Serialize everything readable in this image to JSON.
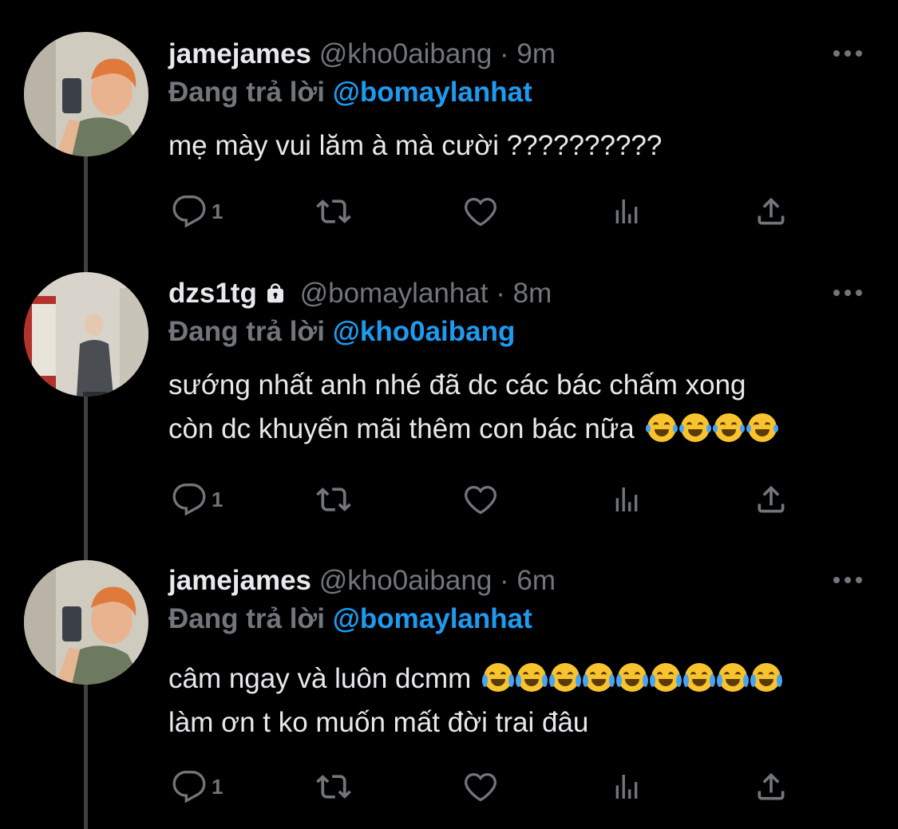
{
  "tweets": [
    {
      "name": "jamejames",
      "handle": "@kho0aibang",
      "dot": "·",
      "time": "9m",
      "replying_prefix": "Đang trả lời",
      "replying_to": "@bomaylanhat",
      "lines": [
        "mẹ mày vui lăm à mà cười ??????????"
      ],
      "reply_count": "1",
      "locked": false
    },
    {
      "name": "dzs1tg",
      "handle": "@bomaylanhat",
      "dot": "·",
      "time": "8m",
      "replying_prefix": "Đang trả lời",
      "replying_to": "@kho0aibang",
      "lines": [
        "sướng nhất anh nhé đã dc các bác chấm xong",
        "còn dc khuyến mãi thêm con bác nữa"
      ],
      "emoji_line": 1,
      "emoji_count": 4,
      "emoji_kind": "joy",
      "reply_count": "1",
      "locked": true
    },
    {
      "name": "jamejames",
      "handle": "@kho0aibang",
      "dot": "·",
      "time": "6m",
      "replying_prefix": "Đang trả lời",
      "replying_to": "@bomaylanhat",
      "lines": [
        "câm ngay và luôn dcmm",
        "làm ơn t ko muốn mất đời trai đâu"
      ],
      "emoji_line": 0,
      "emoji_count": 9,
      "emoji_kind": "sob",
      "reply_count": "1",
      "locked": false
    }
  ],
  "icons": {
    "more": "more-horizontal-icon",
    "reply": "reply-icon",
    "retweet": "retweet-icon",
    "like": "heart-icon",
    "views": "views-chart-icon",
    "share": "share-icon",
    "lock": "lock-icon"
  },
  "colors": {
    "background": "#000000",
    "text": "#e7e9ea",
    "secondary": "#71767b",
    "mention": "#1d9bf0",
    "thread_line": "#3e4144"
  }
}
